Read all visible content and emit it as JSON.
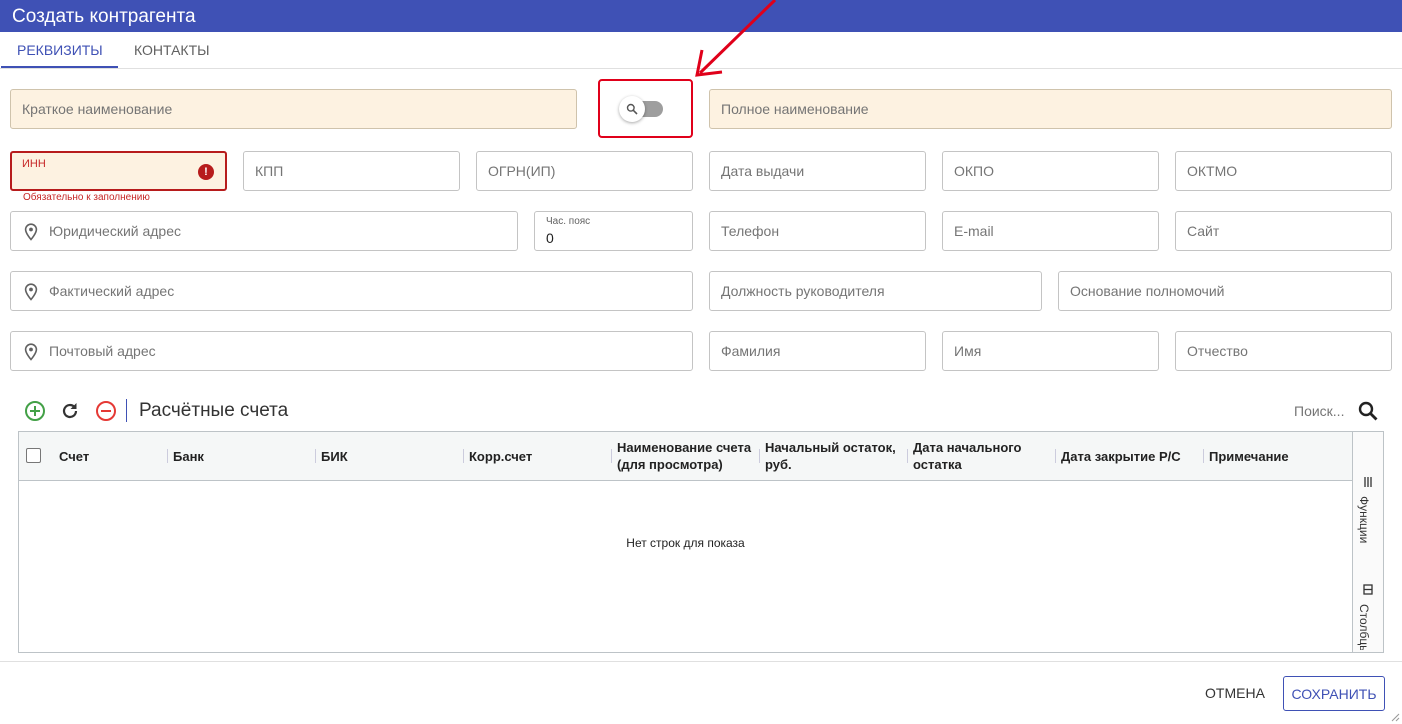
{
  "window": {
    "title": "Создать контрагента"
  },
  "tabs": [
    {
      "label": "РЕКВИЗИТЫ",
      "active": true
    },
    {
      "label": "КОНТАКТЫ",
      "active": false
    }
  ],
  "form": {
    "short_name": {
      "placeholder": "Краткое наименование"
    },
    "full_name": {
      "placeholder": "Полное наименование"
    },
    "search_toggle": {
      "icon": "search-icon",
      "on": false
    },
    "inn": {
      "label": "ИНН",
      "helper": "Обязательно к заполнению",
      "error_icon": "!"
    },
    "kpp": {
      "placeholder": "КПП"
    },
    "ogrn": {
      "placeholder": "ОГРН(ИП)"
    },
    "issue_date": {
      "placeholder": "Дата выдачи"
    },
    "okpo": {
      "placeholder": "ОКПО"
    },
    "oktmo": {
      "placeholder": "ОКТМО"
    },
    "legal_address": {
      "placeholder": "Юридический адрес"
    },
    "timezone": {
      "label": "Час. пояс",
      "value": "0"
    },
    "phone": {
      "placeholder": "Телефон"
    },
    "email": {
      "placeholder": "E-mail"
    },
    "site": {
      "placeholder": "Сайт"
    },
    "actual_address": {
      "placeholder": "Фактический адрес"
    },
    "head_position": {
      "placeholder": "Должность руководителя"
    },
    "authority_basis": {
      "placeholder": "Основание полномочий"
    },
    "postal_address": {
      "placeholder": "Почтовый адрес"
    },
    "last_name": {
      "placeholder": "Фамилия"
    },
    "first_name": {
      "placeholder": "Имя"
    },
    "patronymic": {
      "placeholder": "Отчество"
    }
  },
  "accounts": {
    "title": "Расчётные счета",
    "search_placeholder": "Поиск...",
    "columns": [
      "Счет",
      "Банк",
      "БИК",
      "Корр.счет",
      "Наименование счета (для просмотра)",
      "Начальный остаток, руб.",
      "Дата начального остатка",
      "Дата закрытие Р/С",
      "Примечание"
    ],
    "empty_text": "Нет строк для показа",
    "side_buttons": [
      {
        "label": "Функции",
        "icon": "menu-icon"
      },
      {
        "label": "Столбцы",
        "icon": "columns-icon"
      }
    ]
  },
  "actions": {
    "cancel": "ОТМЕНА",
    "save": "СОХРАНИТЬ"
  },
  "colors": {
    "primary": "#3f51b5",
    "error": "#b71c1c",
    "required_bg": "#fdf2e1",
    "annotation": "#e0001a",
    "add": "#43a047",
    "remove": "#e53935"
  }
}
